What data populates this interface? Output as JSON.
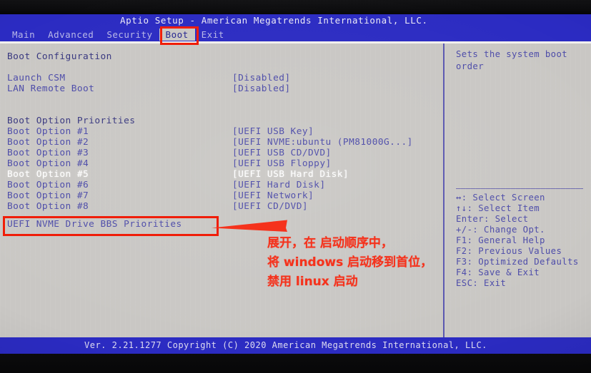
{
  "window": {
    "title": "Aptio Setup - American Megatrends International, LLC.",
    "footer": "Ver. 2.21.1277 Copyright (C) 2020 American Megatrends International, LLC."
  },
  "menu": {
    "items": [
      {
        "label": "Main",
        "active": false
      },
      {
        "label": "Advanced",
        "active": false
      },
      {
        "label": "Security",
        "active": false
      },
      {
        "label": "Boot",
        "active": true
      },
      {
        "label": "Exit",
        "active": false
      }
    ]
  },
  "main": {
    "section_title": "Boot Configuration",
    "settings": [
      {
        "label": "Launch CSM",
        "value": "[Disabled]"
      },
      {
        "label": "LAN Remote Boot",
        "value": "[Disabled]"
      }
    ],
    "priorities_title": "Boot Option Priorities",
    "boot_options": [
      {
        "label": "Boot Option #1",
        "value": "[UEFI USB Key]",
        "selected": false
      },
      {
        "label": "Boot Option #2",
        "value": "[UEFI NVME:ubuntu (PM81000G...]",
        "selected": false
      },
      {
        "label": "Boot Option #3",
        "value": "[UEFI USB CD/DVD]",
        "selected": false
      },
      {
        "label": "Boot Option #4",
        "value": "[UEFI USB Floppy]",
        "selected": false
      },
      {
        "label": "Boot Option #5",
        "value": "[UEFI USB Hard Disk]",
        "selected": true
      },
      {
        "label": "Boot Option #6",
        "value": "[UEFI Hard Disk]",
        "selected": false
      },
      {
        "label": "Boot Option #7",
        "value": "[UEFI Network]",
        "selected": false
      },
      {
        "label": "Boot Option #8",
        "value": "[UEFI CD/DVD]",
        "selected": false
      }
    ],
    "submenu": {
      "label": "UEFI NVME Drive BBS Priorities"
    }
  },
  "help": {
    "description": "Sets the system boot order",
    "keys": [
      "↔: Select Screen",
      "↑↓: Select Item",
      "Enter: Select",
      "+/-: Change Opt.",
      "F1: General Help",
      "F2: Previous Values",
      "F3: Optimized Defaults",
      "F4: Save & Exit",
      "ESC: Exit"
    ]
  },
  "annotations": {
    "color": "#f5321c",
    "note_lines": [
      "展开，在 启动顺序中，",
      "将 windows 启动移到首位，",
      "禁用 linux 启动"
    ],
    "highlight_tab": "Boot",
    "highlight_item": "UEFI NVME Drive BBS Priorities"
  }
}
